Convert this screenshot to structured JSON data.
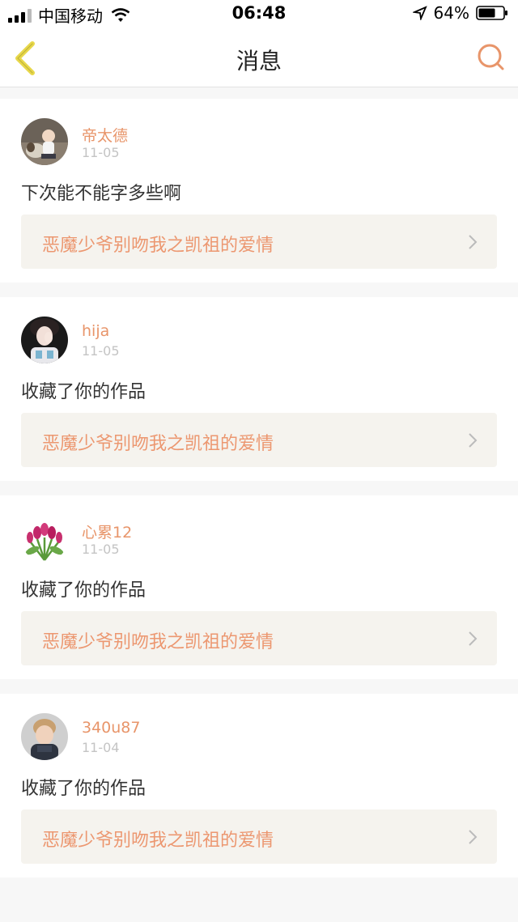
{
  "status": {
    "carrier": "中国移动",
    "time": "06:48",
    "battery": "64%"
  },
  "nav": {
    "title": "消息"
  },
  "messages": [
    {
      "name": "帝太德",
      "date": "11-05",
      "text": "下次能不能字多些啊",
      "work": "恶魔少爷别吻我之凯祖的爱情"
    },
    {
      "name": "hija",
      "date": "11-05",
      "text": "收藏了你的作品",
      "work": "恶魔少爷别吻我之凯祖的爱情"
    },
    {
      "name": "心累12",
      "date": "11-05",
      "text": "收藏了你的作品",
      "work": "恶魔少爷别吻我之凯祖的爱情"
    },
    {
      "name": "340u87",
      "date": "11-04",
      "text": "收藏了你的作品",
      "work": "恶魔少爷别吻我之凯祖的爱情"
    }
  ],
  "colors": {
    "accent": "#e8956a",
    "back_icon": "#e8d84a"
  }
}
